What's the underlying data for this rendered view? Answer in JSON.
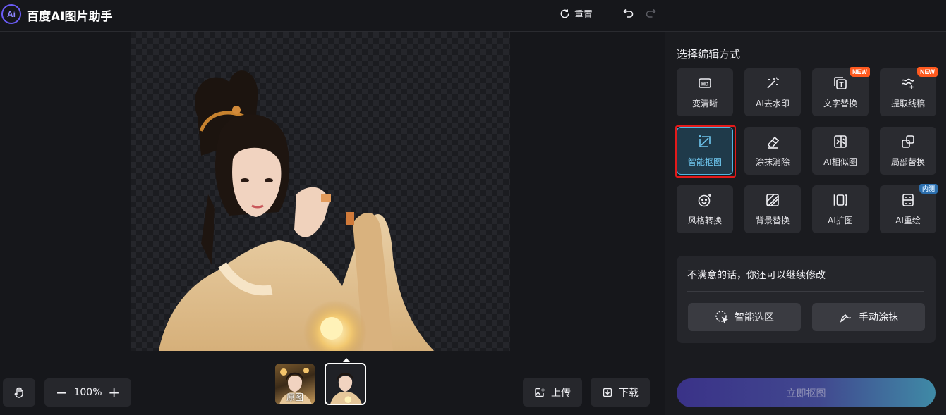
{
  "header": {
    "app_title": "百度AI图片助手",
    "logo_text": "Ai",
    "reset_label": "重置"
  },
  "canvas": {
    "zoom": "100%"
  },
  "toolbar": {
    "upload_label": "上传",
    "download_label": "下载"
  },
  "thumbnails": [
    {
      "label": "原图",
      "selected": false
    },
    {
      "label": "",
      "selected": true
    }
  ],
  "panel": {
    "title": "选择编辑方式",
    "tools": [
      {
        "label": "变清晰",
        "icon": "hd-icon",
        "badge": ""
      },
      {
        "label": "AI去水印",
        "icon": "magic-wand-icon",
        "badge": ""
      },
      {
        "label": "文字替换",
        "icon": "text-replace-icon",
        "badge": "NEW"
      },
      {
        "label": "提取线稿",
        "icon": "line-art-icon",
        "badge": "NEW"
      },
      {
        "label": "智能抠图",
        "icon": "smart-cutout-icon",
        "badge": "",
        "active": true
      },
      {
        "label": "涂抹消除",
        "icon": "eraser-icon",
        "badge": ""
      },
      {
        "label": "AI相似图",
        "icon": "similar-image-icon",
        "badge": ""
      },
      {
        "label": "局部替换",
        "icon": "partial-replace-icon",
        "badge": ""
      },
      {
        "label": "风格转换",
        "icon": "style-transfer-icon",
        "badge": ""
      },
      {
        "label": "背景替换",
        "icon": "background-replace-icon",
        "badge": ""
      },
      {
        "label": "AI扩图",
        "icon": "expand-icon",
        "badge": ""
      },
      {
        "label": "AI重绘",
        "icon": "redraw-icon",
        "badge": "内测"
      }
    ],
    "refine": {
      "title": "不满意的话，你还可以继续修改",
      "smart_select_label": "智能选区",
      "manual_brush_label": "手动涂抹"
    },
    "apply_label": "立即抠图"
  },
  "colors": {
    "background": "#16171b",
    "panel": "#1a1b1f",
    "card": "#2a2b30",
    "accent": "#4fb6e2",
    "badge_new": "#ff5a1f",
    "highlight_outline": "#e31a1a"
  }
}
